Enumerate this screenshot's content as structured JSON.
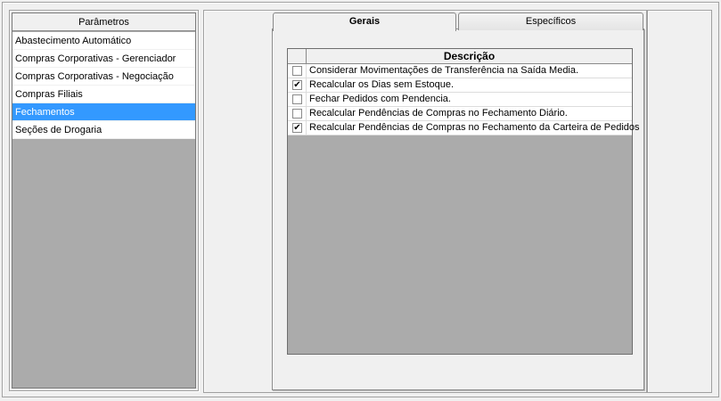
{
  "parameters": {
    "header": "Parâmetros",
    "items": [
      {
        "label": "Abastecimento Automático",
        "selected": false
      },
      {
        "label": "Compras Corporativas - Gerenciador",
        "selected": false
      },
      {
        "label": "Compras Corporativas - Negociação",
        "selected": false
      },
      {
        "label": "Compras Filiais",
        "selected": false
      },
      {
        "label": "Fechamentos",
        "selected": true
      },
      {
        "label": "Seções de Drogaria",
        "selected": false
      }
    ]
  },
  "tabs": [
    {
      "label": "Gerais",
      "active": true
    },
    {
      "label": "Específicos",
      "active": false
    }
  ],
  "grid": {
    "header": "Descrição",
    "rows": [
      {
        "checked": false,
        "description": "Considerar Movimentações de Transferência na Saída Media."
      },
      {
        "checked": true,
        "description": "Recalcular os Dias sem Estoque."
      },
      {
        "checked": false,
        "description": "Fechar Pedidos com Pendencia."
      },
      {
        "checked": false,
        "description": "Recalcular Pendências de Compras no Fechamento Diário."
      },
      {
        "checked": true,
        "description": "Recalcular Pendências de Compras no Fechamento da Carteira de Pedidos"
      }
    ]
  },
  "colors": {
    "selection": "#3399ff",
    "grid_background": "#ababab",
    "window_background": "#f0f0f0"
  }
}
